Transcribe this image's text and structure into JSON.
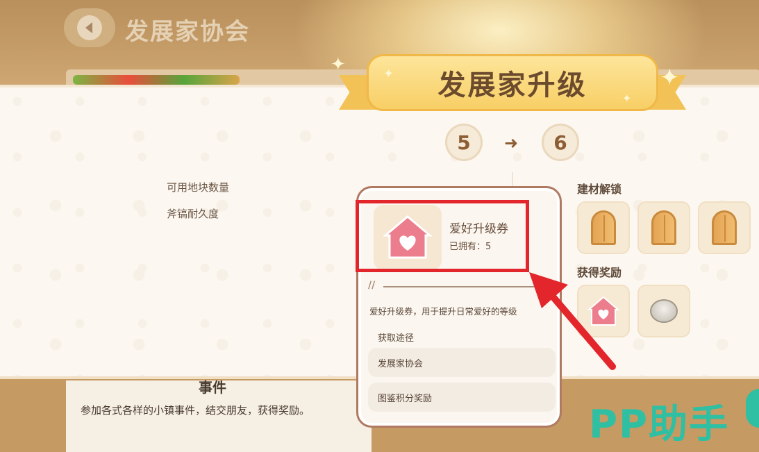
{
  "header": {
    "title": "发展家协会"
  },
  "ribbon": {
    "title": "发展家升级"
  },
  "level": {
    "from": "5",
    "to": "6"
  },
  "stats": {
    "items": [
      {
        "label": "可用地块数量"
      },
      {
        "label": "斧镐耐久度"
      }
    ]
  },
  "unlock_section": {
    "title": "建材解锁"
  },
  "reward_section": {
    "title": "获得奖励"
  },
  "popup": {
    "name": "爱好升级券",
    "owned": "已拥有：5",
    "description": "爱好升级券，用于提升日常爱好的等级",
    "sources_title": "获取途径",
    "sources": [
      "发展家协会",
      "图鉴积分奖励"
    ]
  },
  "lower": {
    "title": "事件",
    "description": "参加各式各样的小镇事件，结交朋友，获得奖励。"
  },
  "watermark": {
    "text": "PP助手"
  },
  "colors": {
    "highlight": "#e3262b",
    "accent": "#f8cf66",
    "watermark": "#2fbfa3"
  }
}
